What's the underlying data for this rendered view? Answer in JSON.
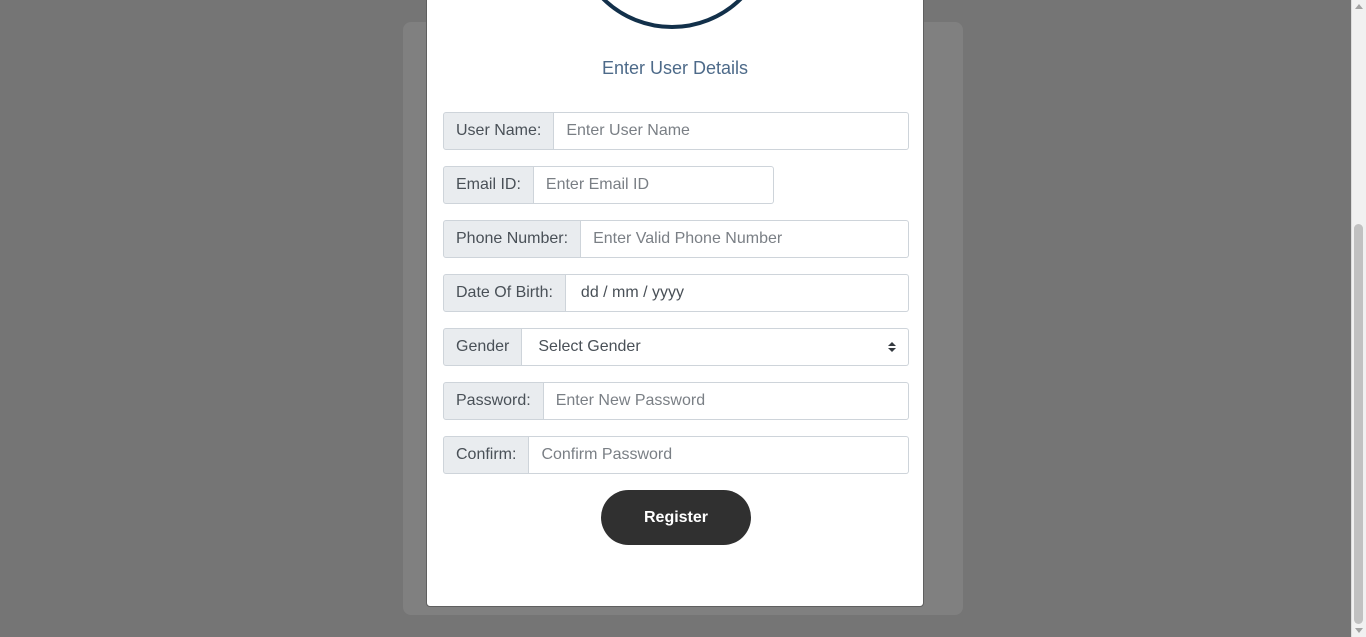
{
  "modal": {
    "title": "Enter User Details"
  },
  "form": {
    "username": {
      "label": "User Name:",
      "placeholder": "Enter User Name"
    },
    "email": {
      "label": "Email ID:",
      "placeholder": "Enter Email ID"
    },
    "phone": {
      "label": "Phone Number:",
      "placeholder": "Enter Valid Phone Number"
    },
    "dob": {
      "label": "Date Of Birth:",
      "value": "dd / mm / yyyy"
    },
    "gender": {
      "label": "Gender",
      "value": "Select Gender"
    },
    "password": {
      "label": "Password:",
      "placeholder": "Enter New Password"
    },
    "confirm": {
      "label": "Confirm:",
      "placeholder": "Confirm Password"
    },
    "submit_label": "Register"
  },
  "colors": {
    "overlay": "#757575",
    "title": "#4d6a89",
    "button": "#303030",
    "avatar_border": "#12304a"
  }
}
